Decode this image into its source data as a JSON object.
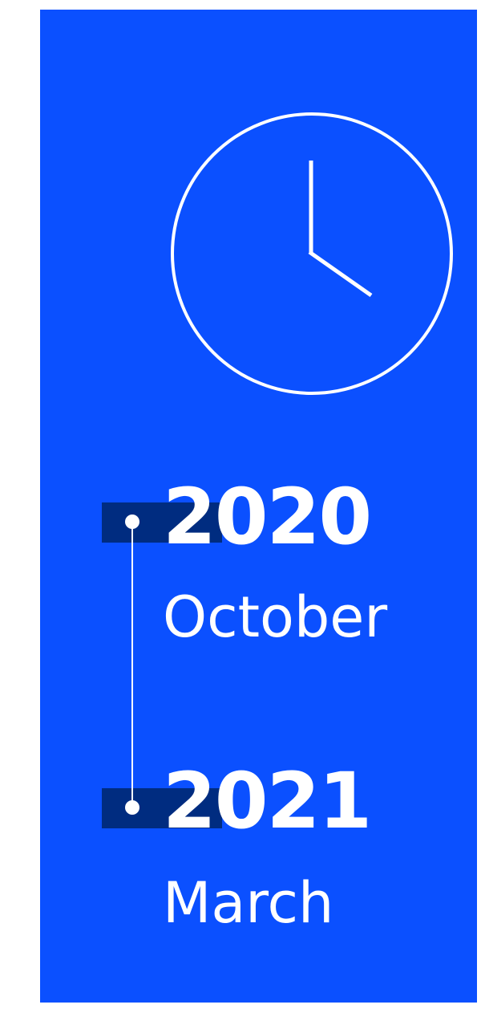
{
  "colors": {
    "panel_background": "#0b50ff",
    "marker_background": "#002c80",
    "foreground": "#ffffff"
  },
  "clock": {
    "icon": "clock-icon"
  },
  "timeline": {
    "entries": [
      {
        "year": "2020",
        "month": "October"
      },
      {
        "year": "2021",
        "month": "March"
      }
    ]
  }
}
